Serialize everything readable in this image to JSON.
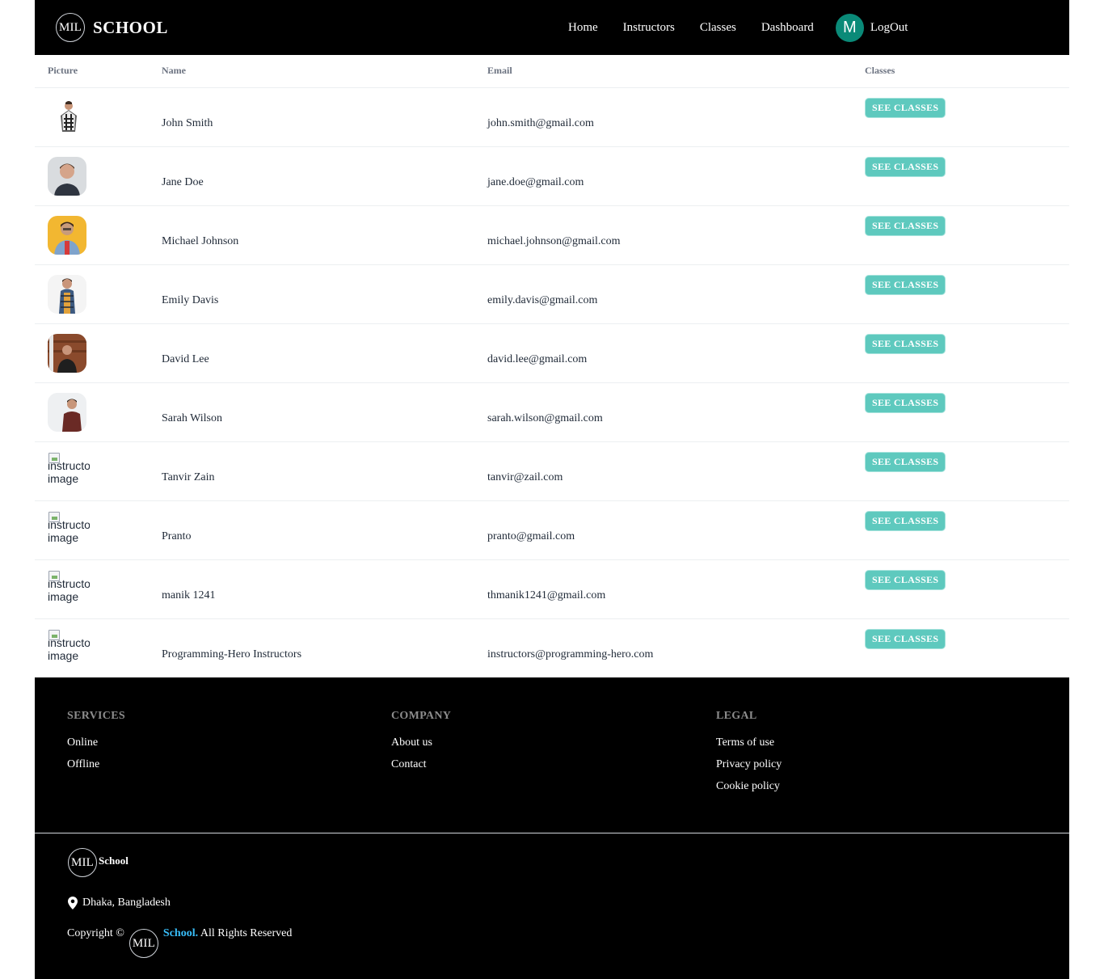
{
  "nav": {
    "logo_text": "MIL",
    "brand": "SCHOOL",
    "links": [
      "Home",
      "Instructors",
      "Classes",
      "Dashboard"
    ],
    "avatar_initial": "M",
    "logout": "LogOut",
    "avatar_color": "#0a8a78"
  },
  "table": {
    "headers": [
      "Picture",
      "Name",
      "Email",
      "Classes"
    ],
    "button_label": "SEE CLASSES",
    "button_color": "#5ec9be",
    "broken_alt": "instructor image",
    "rows": [
      {
        "name": "John Smith",
        "email": "john.smith@gmail.com",
        "picture": "photo"
      },
      {
        "name": "Jane Doe",
        "email": "jane.doe@gmail.com",
        "picture": "photo"
      },
      {
        "name": "Michael Johnson",
        "email": "michael.johnson@gmail.com",
        "picture": "photo"
      },
      {
        "name": "Emily Davis",
        "email": "emily.davis@gmail.com",
        "picture": "photo"
      },
      {
        "name": "David Lee",
        "email": "david.lee@gmail.com",
        "picture": "photo"
      },
      {
        "name": "Sarah Wilson",
        "email": "sarah.wilson@gmail.com",
        "picture": "photo"
      },
      {
        "name": "Tanvir Zain",
        "email": "tanvir@zail.com",
        "picture": "broken"
      },
      {
        "name": "Pranto",
        "email": "pranto@gmail.com",
        "picture": "broken"
      },
      {
        "name": "manik 1241",
        "email": "thmanik1241@gmail.com",
        "picture": "broken"
      },
      {
        "name": "Programming-Hero Instructors",
        "email": "instructors@programming-hero.com",
        "picture": "broken"
      }
    ]
  },
  "footer": {
    "services": {
      "title": "SERVICES",
      "links": [
        "Online",
        "Offline"
      ]
    },
    "company": {
      "title": "COMPANY",
      "links": [
        "About us",
        "Contact"
      ]
    },
    "legal": {
      "title": "LEGAL",
      "links": [
        "Terms of use",
        "Privacy policy",
        "Cookie policy"
      ]
    },
    "logo_text": "MIL",
    "school_label": "School",
    "address": "Dhaka, Bangladesh",
    "copyright_prefix": "Copyright ©",
    "copyright_brand": "School.",
    "copyright_suffix": " All Rights Reserved"
  }
}
